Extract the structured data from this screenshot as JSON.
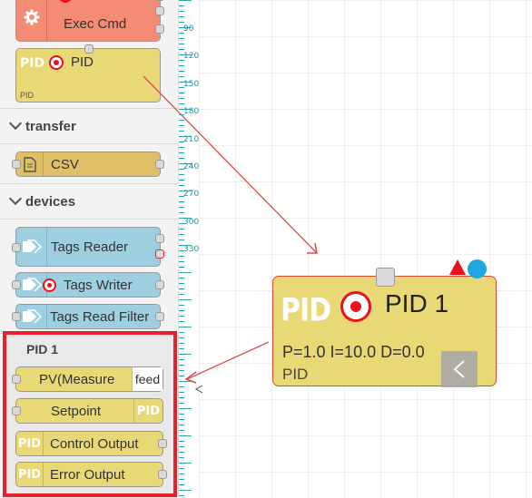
{
  "palette": {
    "exec_node": {
      "label": "Exec Cmd",
      "icon": "gear-icon",
      "color": "#f48b74"
    },
    "pid_node": {
      "icon_text": "PID",
      "label": "PID",
      "sub": "PID",
      "color": "#e9d876"
    },
    "categories": [
      {
        "label": "transfer"
      },
      {
        "label": "devices"
      }
    ],
    "csv_node": {
      "label": "CSV",
      "icon": "file-icon",
      "color": "#dfc066"
    },
    "devices": [
      {
        "label": "Tags Reader",
        "icon": "tags-icon",
        "color": "#9ecfe0"
      },
      {
        "label": "Tags Writer",
        "icon": "tags-icon",
        "color": "#9ecfe0"
      },
      {
        "label": "Tags Read Filter",
        "icon": "tags-icon",
        "color": "#9ecfe0"
      }
    ]
  },
  "ruler": {
    "labels": [
      "90",
      "120",
      "150",
      "180",
      "210",
      "240",
      "270",
      "300",
      "330"
    ]
  },
  "selection_panel": {
    "title": "PID 1",
    "items": [
      {
        "label": "PV(Measure",
        "tag": "feed"
      },
      {
        "label": "Setpoint",
        "badge": "PID"
      },
      {
        "badge": "PID",
        "label": "Control Output"
      },
      {
        "badge": "PID",
        "label": "Error Output"
      }
    ]
  },
  "canvas_node": {
    "logo": "PID",
    "title": "PID 1",
    "params": "P=1.0 I=10.0 D=0.0",
    "sub": "PID",
    "collapse_icon": "chevron-left-icon"
  },
  "colors": {
    "accent_red": "#e2232b",
    "link_red": "#e24a4a",
    "status_blue": "#1ea7e0",
    "status_red": "#e8121c",
    "ruler_teal": "#2fa3ad"
  }
}
